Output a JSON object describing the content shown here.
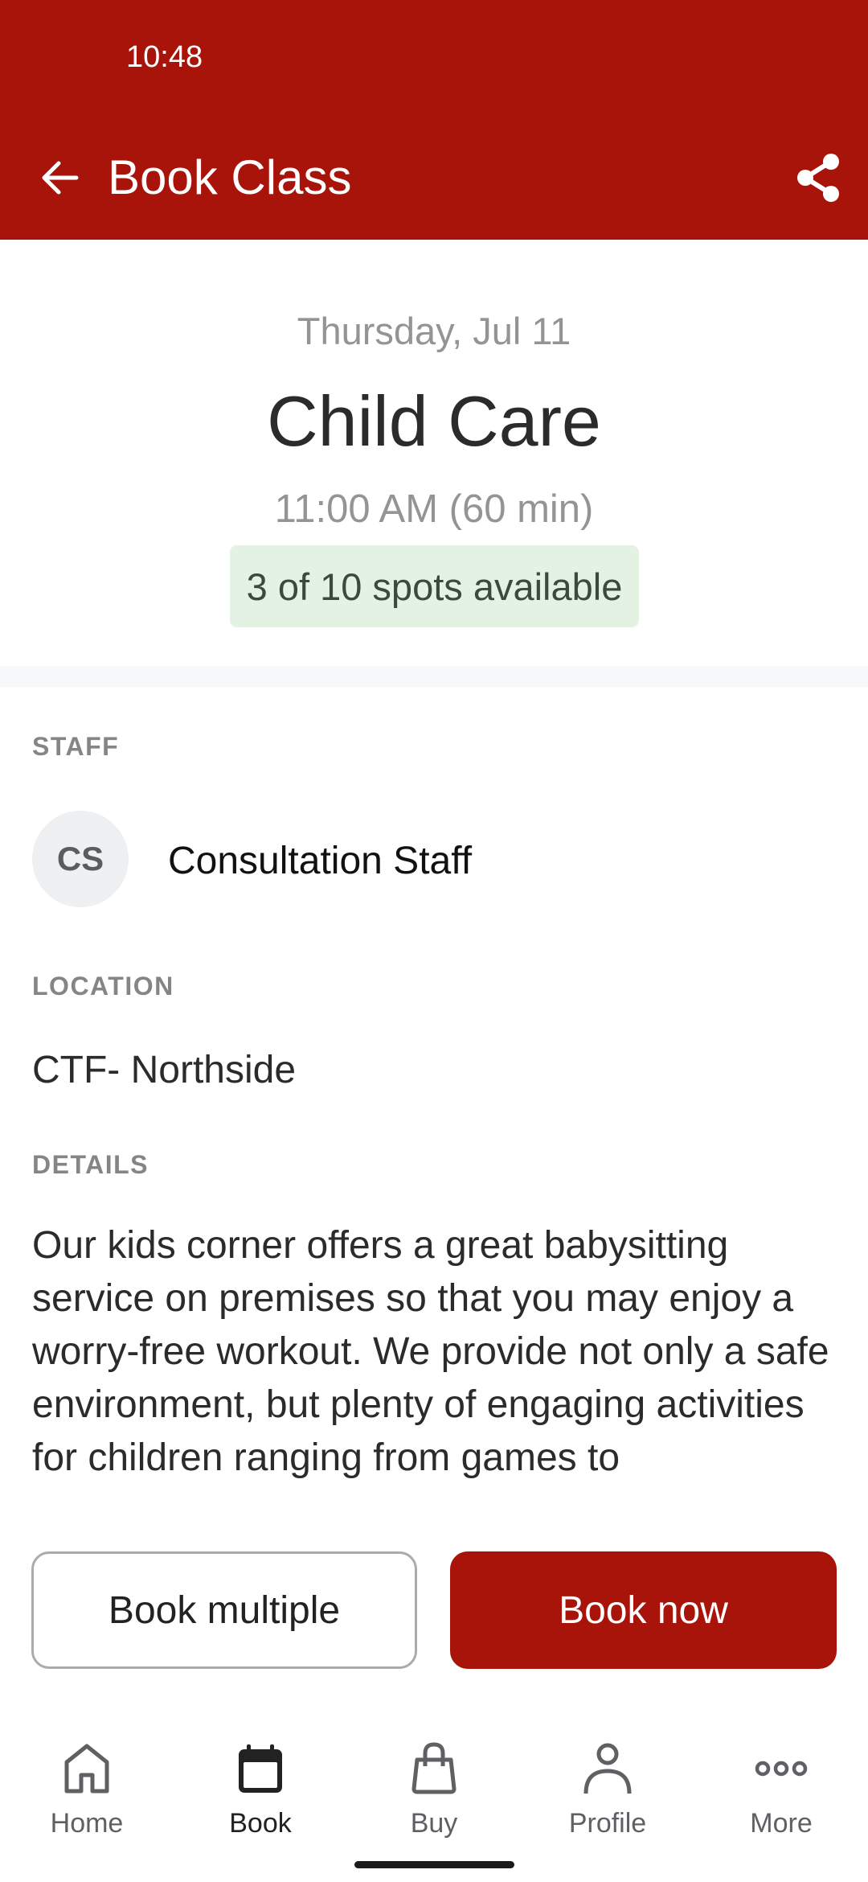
{
  "status_bar": {
    "time": "10:48"
  },
  "app_bar": {
    "title": "Book Class",
    "back_icon": "arrow-left-icon",
    "share_icon": "share-icon"
  },
  "class": {
    "date": "Thursday, Jul 11",
    "title": "Child Care",
    "time": "11:00 AM (60 min)",
    "spots": "3 of 10 spots available",
    "spots_available": 3,
    "spots_total": 10
  },
  "staff": {
    "label": "STAFF",
    "initials": "CS",
    "name": "Consultation Staff"
  },
  "location": {
    "label": "LOCATION",
    "value": "CTF- Northside"
  },
  "details": {
    "label": "DETAILS",
    "text": "Our kids corner offers a great babysitting service on premises so that you may enjoy a worry-free workout. We provide not only a safe environment, but plenty of engaging activities for children ranging from games to"
  },
  "actions": {
    "book_multiple": "Book multiple",
    "book_now": "Book now"
  },
  "bottom_nav": {
    "items": [
      {
        "label": "Home",
        "icon": "home-icon",
        "active": false
      },
      {
        "label": "Book",
        "icon": "calendar-icon",
        "active": true
      },
      {
        "label": "Buy",
        "icon": "shopping-bag-icon",
        "active": false
      },
      {
        "label": "Profile",
        "icon": "profile-icon",
        "active": false
      },
      {
        "label": "More",
        "icon": "more-icon",
        "active": false
      }
    ]
  },
  "colors": {
    "brand": "#A8140A",
    "badge_bg": "#E4F2E4",
    "badge_text": "#3A4A3C"
  }
}
